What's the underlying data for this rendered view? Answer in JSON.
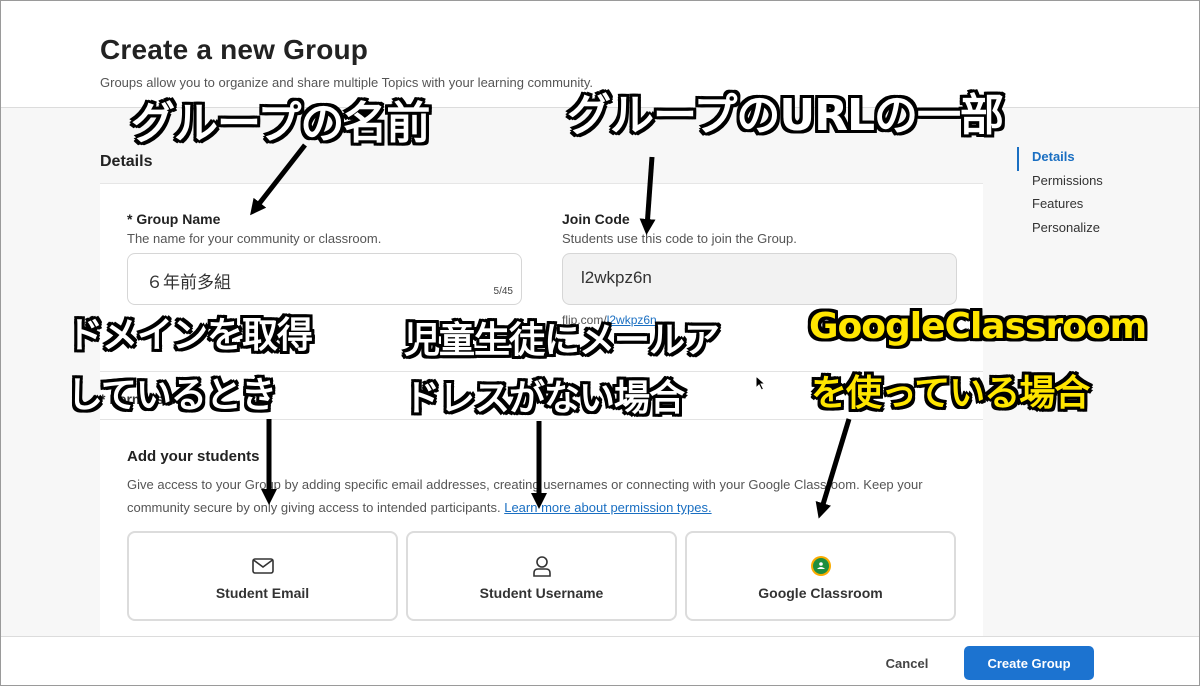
{
  "page": {
    "title": "Create a new Group",
    "subtitle": "Groups allow you to organize and share multiple Topics with your learning community."
  },
  "details": {
    "section_title": "Details",
    "group_name": {
      "label": "* Group Name",
      "help": "The name for your community or classroom.",
      "value": "６年前多組",
      "counter": "5/45"
    },
    "join_code": {
      "label": "Join Code",
      "help": "Students use this code to join the Group.",
      "value": "l2wkpz6n",
      "link_prefix": "flip.com/",
      "link_text": "l2wkpz6n"
    }
  },
  "permissions": {
    "label": "* Permissions",
    "add_title": "Add your students",
    "desc": "Give access to your Group by adding specific email addresses, creating usernames or connecting with your Google Classroom. Keep your community secure by only giving access to intended participants.",
    "learn_more": "Learn more about permission types.",
    "options": [
      {
        "label": "Student Email",
        "icon": "envelope-icon"
      },
      {
        "label": "Student Username",
        "icon": "person-icon"
      },
      {
        "label": "Google Classroom",
        "icon": "google-classroom-icon"
      }
    ]
  },
  "sidebar": {
    "items": [
      {
        "label": "Details",
        "active": true
      },
      {
        "label": "Permissions",
        "active": false
      },
      {
        "label": "Features",
        "active": false
      },
      {
        "label": "Personalize",
        "active": false
      }
    ]
  },
  "footer": {
    "cancel": "Cancel",
    "create": "Create Group"
  },
  "annotations": {
    "group_name": "グループの名前",
    "url_part": "グループのURLの一部",
    "domain_line1": "ドメインを取得",
    "domain_line2": "しているとき",
    "no_email_line1": "児童生徒にメールア",
    "no_email_line2": "ドレスがない場合",
    "gc_line1": "GoogleClassroom",
    "gc_line2": "を使っている場合"
  },
  "colors": {
    "accent": "#1c73d0",
    "annotation_white": "#ffffff",
    "annotation_yellow": "#ffe600"
  }
}
